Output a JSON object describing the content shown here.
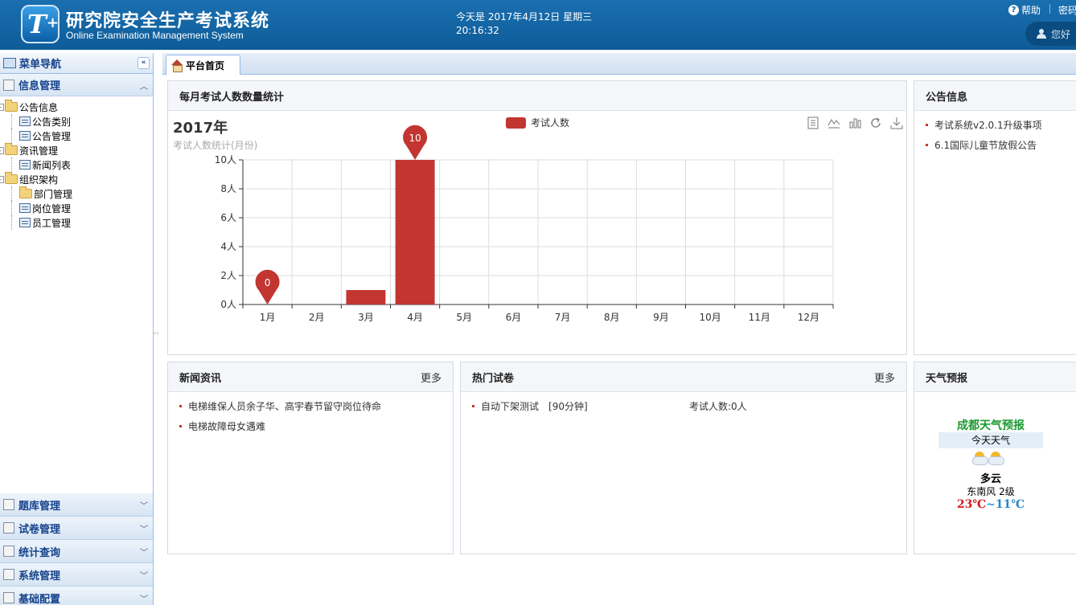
{
  "header": {
    "title": "研究院安全生产考试系统",
    "subtitle": "Online Examination Management System",
    "date": "今天是 2017年4月12日 星期三",
    "time": "20:16:32",
    "help": "帮助",
    "password": "密码",
    "user_greeting": "您好"
  },
  "sidebar": {
    "title": "菜单导航",
    "sections": [
      {
        "label": "信息管理",
        "icon": "edit-icon"
      },
      {
        "label": "题库管理",
        "icon": "edit-icon"
      },
      {
        "label": "试卷管理",
        "icon": "document-icon"
      },
      {
        "label": "统计查询",
        "icon": "chart-icon"
      },
      {
        "label": "系统管理",
        "icon": "computer-icon"
      },
      {
        "label": "基础配置",
        "icon": "gear-icon"
      }
    ],
    "tree": [
      {
        "label": "公告信息",
        "children": [
          "公告类别",
          "公告管理"
        ]
      },
      {
        "label": "资讯管理",
        "children": [
          "新闻列表"
        ]
      },
      {
        "label": "组织架构",
        "children": [
          "部门管理",
          "岗位管理",
          "员工管理"
        ]
      }
    ]
  },
  "tabs": [
    {
      "label": "平台首页"
    }
  ],
  "chart_panel": {
    "title": "每月考试人数数量统计",
    "chart_data": {
      "type": "bar",
      "title": "2017年",
      "subtitle": "考试人数统计(月份)",
      "categories": [
        "1月",
        "2月",
        "3月",
        "4月",
        "5月",
        "6月",
        "7月",
        "8月",
        "9月",
        "10月",
        "11月",
        "12月"
      ],
      "series": [
        {
          "name": "考试人数",
          "values": [
            0,
            0,
            1,
            10,
            0,
            0,
            0,
            0,
            0,
            0,
            0,
            0
          ],
          "color": "#c23531"
        }
      ],
      "ylim": [
        0,
        10
      ],
      "yticks": [
        0,
        2,
        4,
        6,
        8,
        10
      ],
      "ytick_labels": [
        "0人",
        "2人",
        "4人",
        "6人",
        "8人",
        "10人"
      ],
      "markers": [
        {
          "category": "1月",
          "value": 0,
          "label": "0"
        },
        {
          "category": "4月",
          "value": 10,
          "label": "10"
        }
      ],
      "legend_position": "top-center",
      "grid": true
    },
    "toolbox": [
      "data-view-icon",
      "line-chart-icon",
      "bar-chart-icon",
      "refresh-icon",
      "download-icon"
    ]
  },
  "notice_panel": {
    "title": "公告信息",
    "items": [
      "考试系统v2.0.1升级事项",
      "6.1国际儿童节放假公告"
    ]
  },
  "news_panel": {
    "title": "新闻资讯",
    "more": "更多",
    "items": [
      "电梯维保人员余子华、高宇春节留守岗位待命",
      "电梯故障母女遇难"
    ]
  },
  "exam_panel": {
    "title": "热门试卷",
    "more": "更多",
    "items": [
      {
        "name": "自动下架测试",
        "duration": "[90分钟]",
        "count": "考试人数:0人"
      }
    ]
  },
  "weather_panel": {
    "title": "天气预报",
    "city_title": "成都天气预报",
    "today": "今天天气",
    "condition": "多云",
    "wind": "东南风 2级",
    "high": "23℃",
    "separator": "~",
    "low": "11℃"
  },
  "colors": {
    "header": "#0e5c98",
    "bar": "#c23531",
    "accent": "#15428b"
  }
}
